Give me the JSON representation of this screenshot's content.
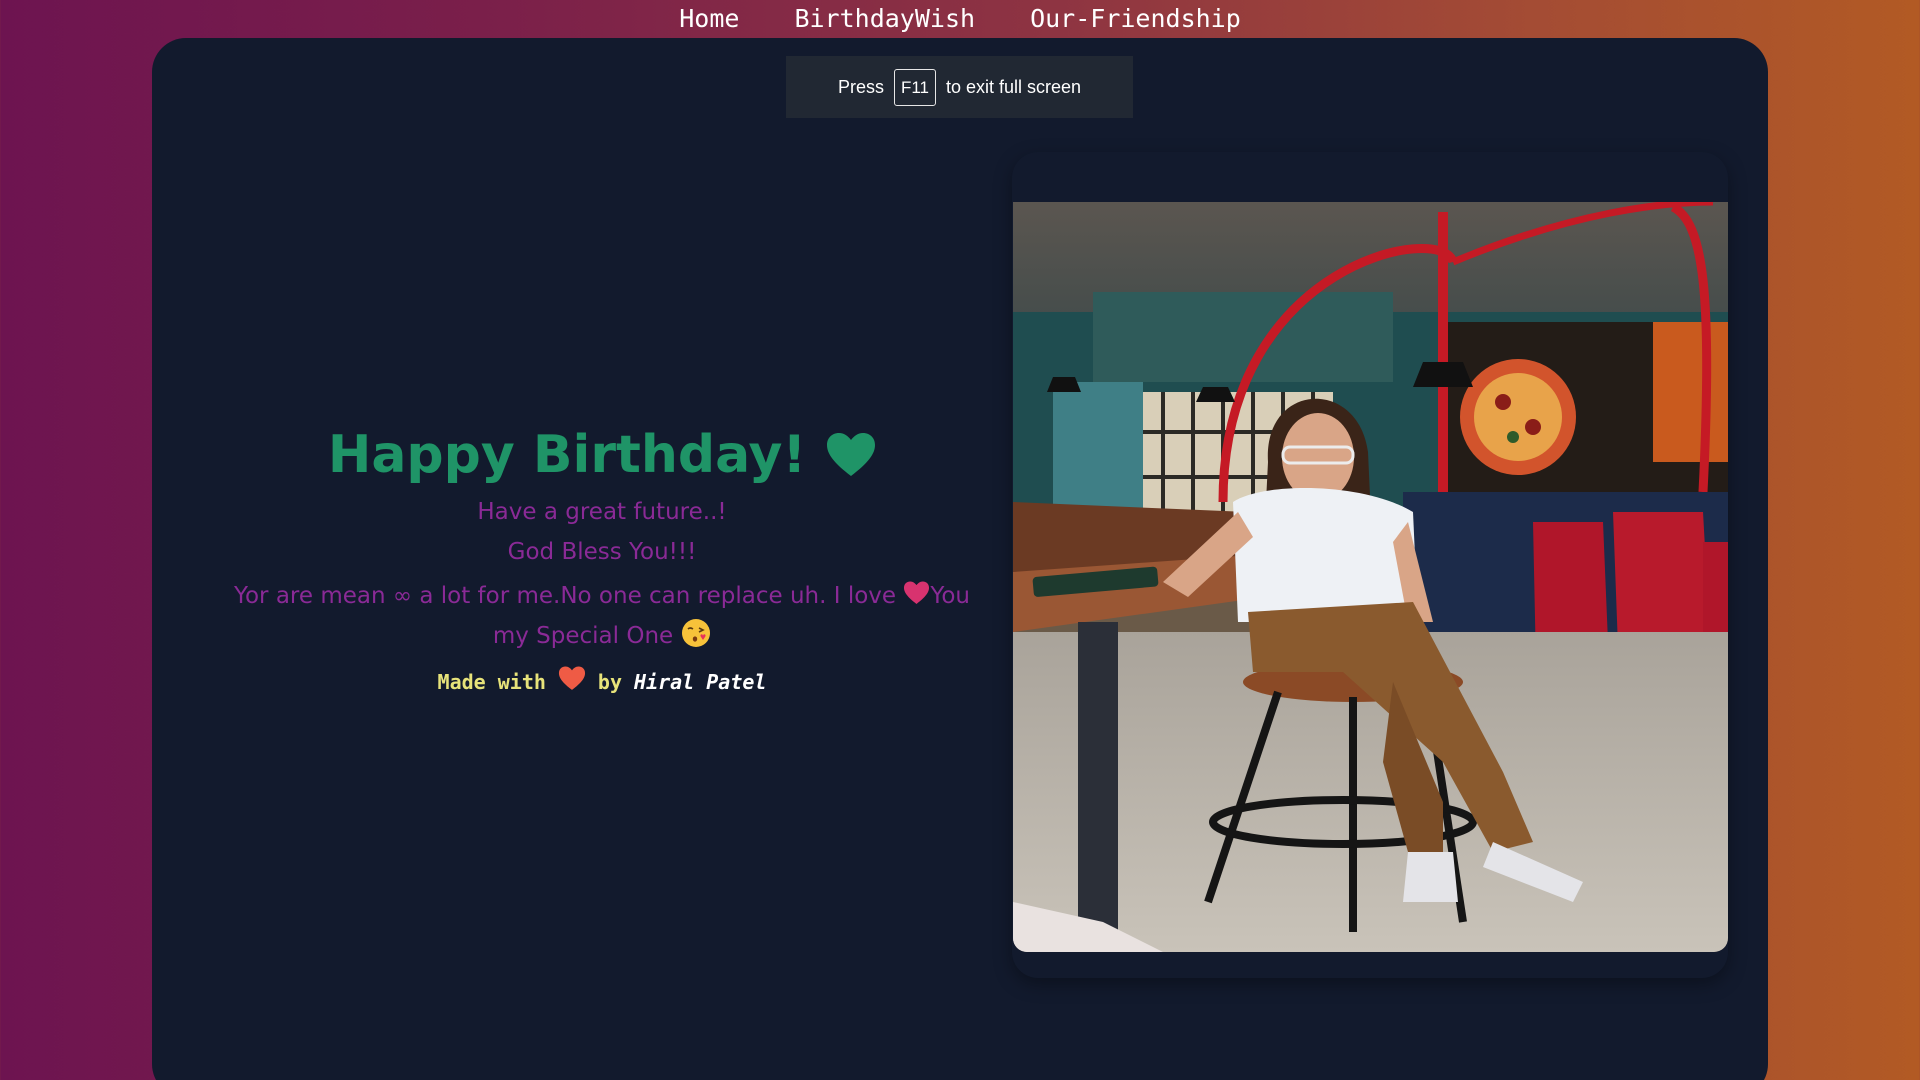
{
  "nav": {
    "items": [
      {
        "label": "Home"
      },
      {
        "label": "BirthdayWish"
      },
      {
        "label": "Our-Friendship"
      }
    ]
  },
  "fullscreen_banner": {
    "prefix": "Press",
    "key": "F11",
    "suffix": "to exit full screen"
  },
  "wish": {
    "title": "Happy Birthday!",
    "line1": "Have a great future..!",
    "line2": "God Bless You!!!",
    "line3_a": "Yor are mean ∞ a lot for me.No one can replace uh. I love ",
    "line3_b": "You",
    "line3_c": "my Special One",
    "made_with": "Made with",
    "by": "by",
    "author": "Hiral Patel"
  },
  "colors": {
    "title": "#1f9467",
    "message": "#8a2a96",
    "footer": "#e7e37a",
    "card": "#121a2d"
  },
  "icons": {
    "title_heart": "green-heart-icon",
    "love_heart": "pink-heart-icon",
    "kiss": "face-blowing-kiss-icon",
    "made_heart": "red-heart-icon"
  }
}
